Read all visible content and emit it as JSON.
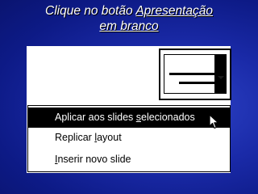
{
  "title": {
    "line1_prefix": "Clique no botão ",
    "line1_link": "Apresentação",
    "line2_link": "em branco"
  },
  "thumbnail": {
    "icon": "blank-presentation-icon",
    "dropdown_icon": "chevron-down-icon"
  },
  "menu": {
    "items": [
      {
        "pre": "Aplicar aos slides ",
        "acc": "s",
        "post": "elecionados",
        "selected": true
      },
      {
        "pre": "Replicar ",
        "acc": "l",
        "post": "ayout",
        "selected": false
      },
      {
        "pre": "",
        "acc": "I",
        "post": "nserir novo slide",
        "selected": false
      }
    ]
  },
  "colors": {
    "background": "#1a2aa8",
    "highlight": "#000000",
    "text": "#ffffff"
  }
}
